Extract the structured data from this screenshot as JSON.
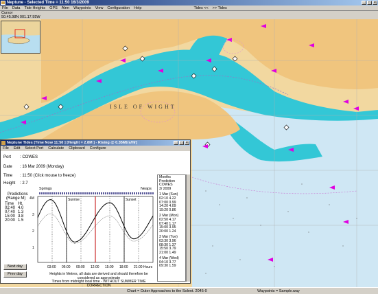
{
  "window": {
    "title": "Neptune - Selected Time = 11:50 16/3/2009"
  },
  "menu": {
    "items": [
      "File",
      "Data",
      "Tide Heights",
      "GPS",
      "Alrm",
      "Waypoints",
      "View",
      "Configuration",
      "Help"
    ],
    "tides_prev": "Tides <<",
    "tides_next": ">> Tides"
  },
  "cursor": {
    "label": "Cursor",
    "position": "50.45.98N  001.17.95W"
  },
  "chart_labels": {
    "isle": "ISLE OF WIGHT"
  },
  "status": {
    "chart": "Chart = Outer Approaches to the Solent. 2045-0",
    "waypoints": "Waypoints = Sample.way"
  },
  "tides_window": {
    "title": "Neptune Tides   [Time Now 11:50 ] [Height = 2.8M ] - Rising @ 0.35Mtrs/Hr]",
    "menu": [
      "File",
      "Edit",
      "Select Port",
      "Calculate",
      "Clipboard",
      "Configure"
    ],
    "port_label": "Port",
    "port": ": COWES",
    "date_label": "Date",
    "date": ": 16 Mar 2009 (Monday)",
    "time_label": "Time",
    "time": ": 11:50   (Click mouse to freeze)",
    "height_label": "Height",
    "height": ": 2.7",
    "predictions_title": "Predictions",
    "predictions_range": "(Range M)",
    "pred_head": [
      "Time",
      "Ht."
    ],
    "predictions": [
      [
        "02:40",
        "4.0"
      ],
      [
        "07:40",
        "1.3"
      ],
      [
        "15:00",
        "3.8"
      ],
      [
        "20:00",
        "1.5"
      ]
    ],
    "next_day": "Next day",
    "prev_day": "Prev day",
    "springs": "Springs",
    "neaps": "Neaps",
    "sunrise": "Sunrise",
    "sunset": "Sunset",
    "yaxis": [
      "4M",
      "3",
      "2",
      "1"
    ],
    "xaxis": [
      "03:00",
      "06:00",
      "09:00",
      "12:00",
      "15:00",
      "18:00",
      "21:00 Hours"
    ],
    "footnote1": "Heights in Metres, all data are derived and should therefore be considered as approximate",
    "footnote2": "Times from midnight local time - WITHOUT SUMMER TIME CORRECTION",
    "monthly": {
      "title": "Months",
      "subtitle": "Prediction",
      "port": "COWES",
      "month": "3/ 2009",
      "days": [
        {
          "day": "1 Mar (Sun)",
          "rows": [
            [
              "02:10",
              "4.22"
            ],
            [
              "07:00",
              "0.99"
            ],
            [
              "14:20",
              "4.09"
            ],
            [
              "19:20",
              "0.86"
            ]
          ]
        },
        {
          "day": "2 Mar (Mon)",
          "rows": [
            [
              "02:50",
              "4.17"
            ],
            [
              "07:40",
              "1.17"
            ],
            [
              "15:00",
              "3.95"
            ],
            [
              "20:00",
              "1.24"
            ]
          ]
        },
        {
          "day": "3 Mar (Tue)",
          "rows": [
            [
              "03:30",
              "3.96"
            ],
            [
              "08:30",
              "1.37"
            ],
            [
              "15:50",
              "3.79"
            ],
            [
              "21:00",
              "1.49"
            ]
          ]
        },
        {
          "day": "4 Mar (Wed)",
          "rows": [
            [
              "04:10",
              "3.77"
            ],
            [
              "09:30",
              "1.59"
            ]
          ]
        }
      ]
    }
  }
}
